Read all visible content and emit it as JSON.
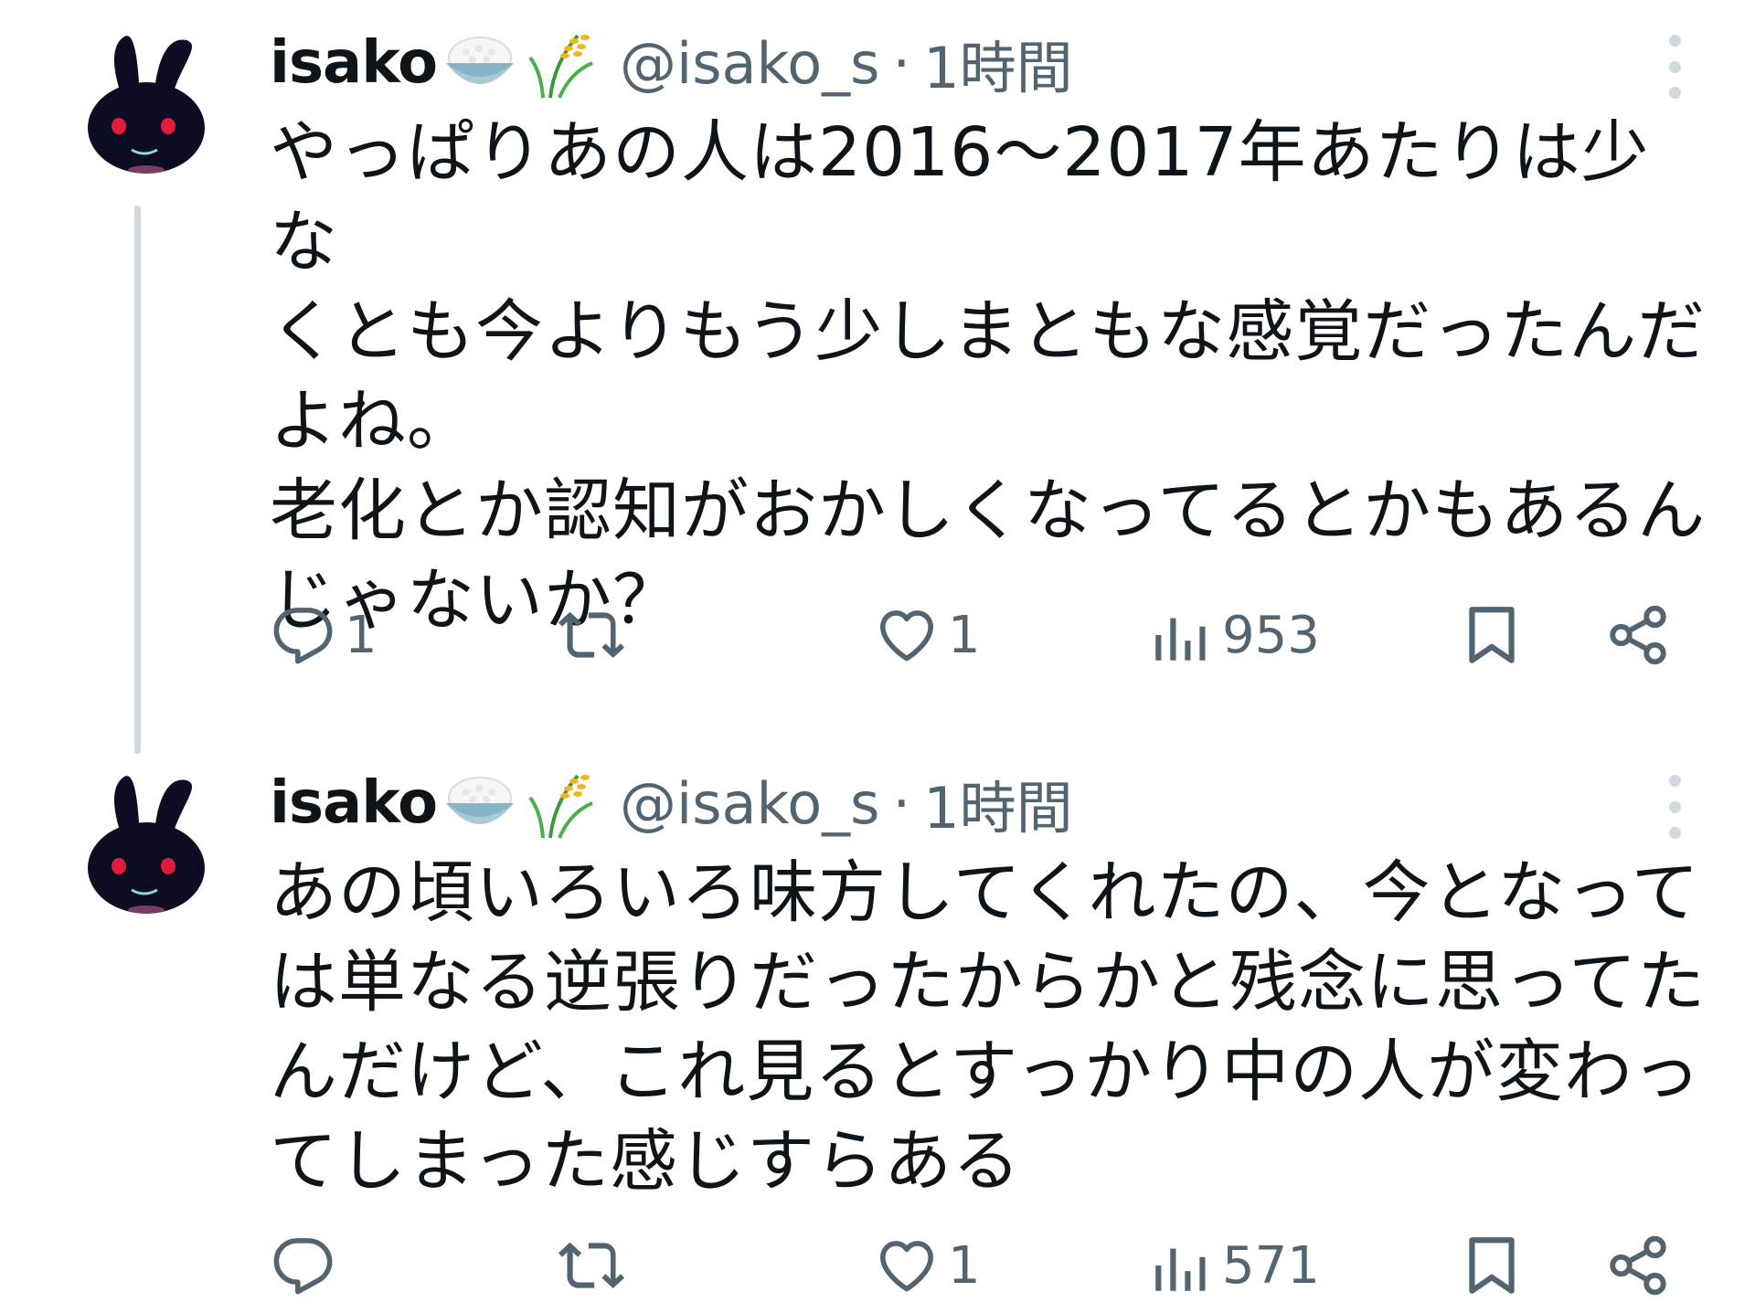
{
  "tweets": [
    {
      "name": "isako",
      "emojis": [
        "rice-bowl-icon",
        "rice-plant-icon"
      ],
      "handle": "@isako_s",
      "separator": "·",
      "time": "1時間",
      "text_lines": [
        "やっぱりあの人は2016〜2017年あたりは少な",
        "くとも今よりもう少しまともな感覚だったんだ",
        "よね。",
        "老化とか認知がおかしくなってるとかもあるん",
        "じゃないか？"
      ],
      "replies": "1",
      "retweets": "",
      "likes": "1",
      "views": "953"
    },
    {
      "name": "isako",
      "emojis": [
        "rice-bowl-icon",
        "rice-plant-icon"
      ],
      "handle": "@isako_s",
      "separator": "·",
      "time": "1時間",
      "text_lines": [
        "あの頃いろいろ味方してくれたの、今となって",
        "は単なる逆張りだったからかと残念に思ってた",
        "んだけど、これ見るとすっかり中の人が変わっ",
        "てしまった感じすらある"
      ],
      "replies": "",
      "retweets": "",
      "likes": "1",
      "views": "571"
    }
  ],
  "colors": {
    "text": "#0f1419",
    "secondary": "#536471",
    "thread_line": "#cfd9de"
  }
}
